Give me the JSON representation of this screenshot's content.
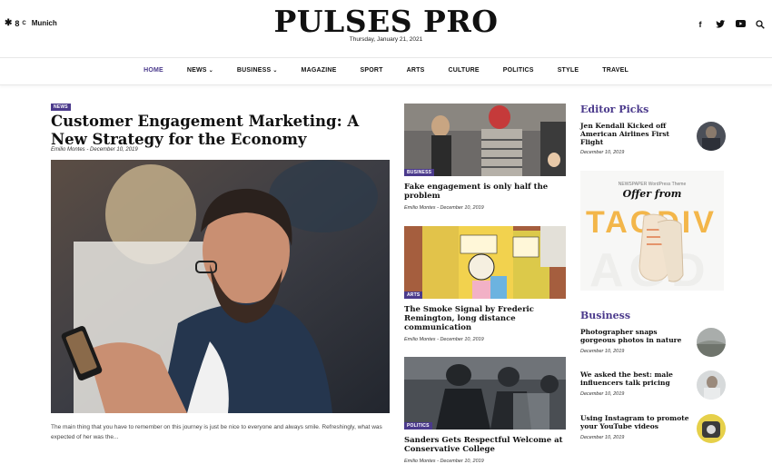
{
  "header": {
    "weather_temp": "8",
    "weather_unit": "C",
    "city": "Munich",
    "logo": "PULSES PRO",
    "date": "Thursday, January 21, 2021",
    "social": [
      "facebook-icon",
      "twitter-icon",
      "youtube-icon",
      "search-icon"
    ]
  },
  "nav": {
    "items": [
      {
        "label": "HOME",
        "active": true
      },
      {
        "label": "NEWS",
        "dropdown": true
      },
      {
        "label": "BUSINESS",
        "dropdown": true
      },
      {
        "label": "MAGAZINE"
      },
      {
        "label": "SPORT"
      },
      {
        "label": "ARTS"
      },
      {
        "label": "CULTURE"
      },
      {
        "label": "POLITICS"
      },
      {
        "label": "STYLE"
      },
      {
        "label": "TRAVEL"
      }
    ]
  },
  "main": {
    "badge": "NEWS",
    "title": "Customer Engagement Marketing: A New Strategy for the Economy",
    "author": "Emilio Montes",
    "sep": " - ",
    "date": "December 10, 2019",
    "excerpt": "The main thing that you have to remember on this journey is just be nice to everyone and always smile. Refreshingly, what was expected of her was the..."
  },
  "middle": [
    {
      "badge": "BUSINESS",
      "title": "Fake engagement is only half the problem",
      "author": "Emilio Montes",
      "date": "December 10, 2019"
    },
    {
      "badge": "ARTS",
      "title": "The Smoke Signal by Frederic Remington, long distance communication",
      "author": "Emilio Montes",
      "date": "December 10, 2019"
    },
    {
      "badge": "POLITICS",
      "title": "Sanders Gets Respectful Welcome at Conservative College",
      "author": "Emilio Montes",
      "date": "December 10, 2019"
    }
  ],
  "editor_picks": {
    "heading": "Editor Picks",
    "items": [
      {
        "title": "Jen Kendall Kicked off American Airlines First Flight",
        "date": "December 10, 2019"
      }
    ]
  },
  "ad": {
    "small": "NEWSPAPER WordPress Theme",
    "offer": "Offer from",
    "brand": "TAGDIV"
  },
  "business": {
    "heading": "Business",
    "items": [
      {
        "title": "Photographer snaps gorgeous photos in nature",
        "date": "December 10, 2019"
      },
      {
        "title": "We asked the best: male influencers talk pricing",
        "date": "December 10, 2019"
      },
      {
        "title": "Using Instagram to promote your YouTube videos",
        "date": "December 10, 2019"
      }
    ]
  },
  "colors": {
    "accent": "#4b3a8c",
    "ad_brand": "#f3b64a"
  }
}
